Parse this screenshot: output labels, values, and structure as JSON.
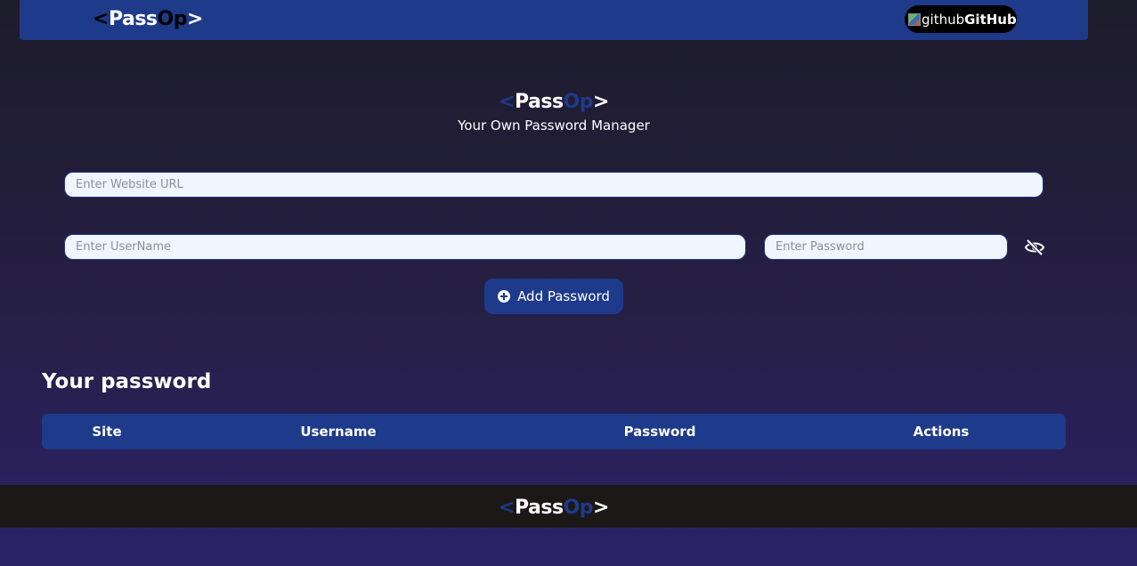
{
  "navbar": {
    "logo": {
      "open": "<",
      "pass": "Pass",
      "op": "Op",
      "close": ">"
    },
    "github_button": {
      "img_alt": "github",
      "label": "GitHub"
    }
  },
  "hero": {
    "logo": {
      "open": "<",
      "pass": "Pass",
      "op": "Op",
      "close": ">"
    },
    "tagline": "Your Own Password Manager"
  },
  "form": {
    "url_placeholder": "Enter Website URL",
    "username_placeholder": "Enter UserName",
    "password_placeholder": "Enter Password",
    "add_button_label": "Add Password"
  },
  "passwords": {
    "title": "Your password",
    "columns": [
      "Site",
      "Username",
      "Password",
      "Actions"
    ],
    "rows": []
  },
  "footer": {
    "logo": {
      "open": "<",
      "pass": "Pass",
      "op": "Op",
      "close": ">"
    }
  },
  "colors": {
    "brand_blue": "#1e3a8a",
    "footer_bg": "#1b1816",
    "input_bg": "#eff6ff"
  }
}
